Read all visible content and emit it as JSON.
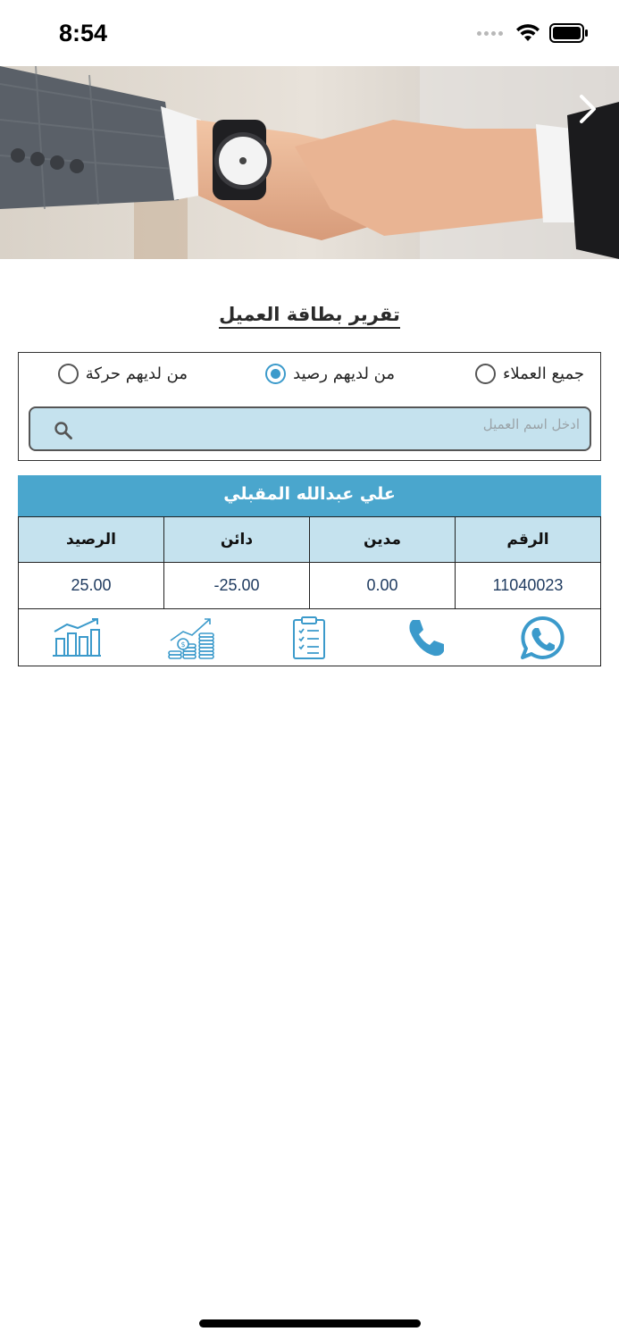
{
  "status_bar": {
    "time": "8:54"
  },
  "banner": {
    "next_icon": "chevron-right-icon"
  },
  "page": {
    "title": "تقرير بطاقة العميل"
  },
  "filter": {
    "options": [
      {
        "label": "جميع العملاء",
        "checked": false
      },
      {
        "label": "من لديهم رصيد",
        "checked": true
      },
      {
        "label": "من لديهم حركة",
        "checked": false
      }
    ],
    "search": {
      "placeholder": "ادخل اسم العميل",
      "value": "",
      "icon": "search-icon"
    }
  },
  "customer": {
    "name": "علي عبدالله المقبلي",
    "columns": [
      "الرقم",
      "مدين",
      "دائن",
      "الرصيد"
    ],
    "values": [
      "11040023",
      "0.00",
      "25.00-",
      "25.00"
    ],
    "actions": [
      "whatsapp-icon",
      "phone-icon",
      "statement-clipboard-icon",
      "money-growth-icon",
      "bar-chart-icon"
    ]
  },
  "colors": {
    "accent": "#4aa6cd",
    "light_accent": "#c5e2ee",
    "icon": "#3b9acb"
  }
}
